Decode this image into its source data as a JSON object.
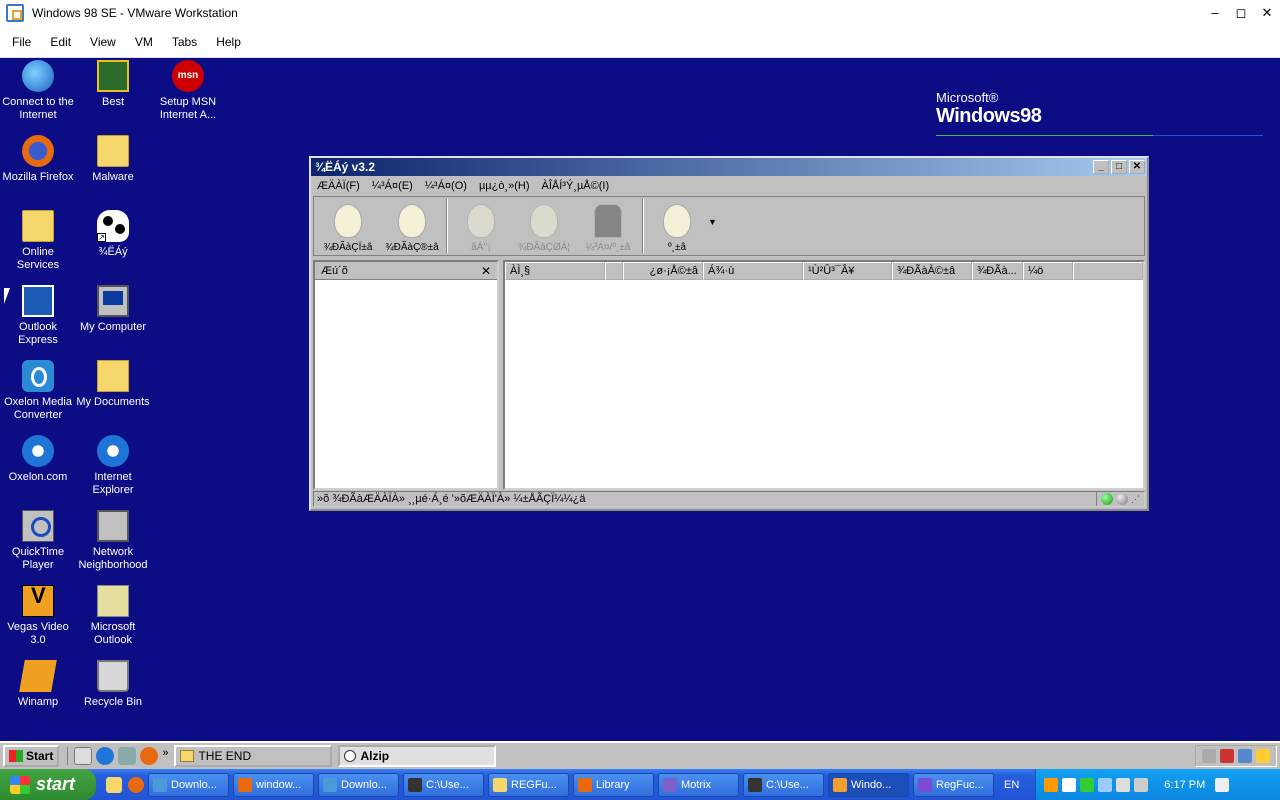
{
  "host": {
    "title": "Windows 98 SE - VMware Workstation",
    "menu": [
      "File",
      "Edit",
      "View",
      "VM",
      "Tabs",
      "Help"
    ],
    "controls": {
      "minimize": "–",
      "maximize": "◻",
      "close": "✕"
    }
  },
  "desktop": {
    "background": "#0c0c84",
    "logo": {
      "line1": "Microsoft®",
      "line2": "Windows98"
    },
    "icons": [
      {
        "label": "Connect to the Internet",
        "icon": "globe"
      },
      {
        "label": "Best",
        "icon": "box"
      },
      {
        "label": "Setup MSN Internet A...",
        "icon": "msn",
        "glyph": "msn"
      },
      {
        "label": "Mozilla Firefox",
        "icon": "firefox"
      },
      {
        "label": "Malware",
        "icon": "folder"
      },
      {
        "label": "Online Services",
        "icon": "folder"
      },
      {
        "label": "¾ËÁý",
        "icon": "cow"
      },
      {
        "label": "Outlook Express",
        "icon": "outlook"
      },
      {
        "label": "My Computer",
        "icon": "computer"
      },
      {
        "label": "Oxelon Media Converter",
        "icon": "oxelon"
      },
      {
        "label": "My Documents",
        "icon": "docs"
      },
      {
        "label": "Oxelon.com",
        "icon": "ie"
      },
      {
        "label": "Internet Explorer",
        "icon": "ie"
      },
      {
        "label": "QuickTime Player",
        "icon": "quick"
      },
      {
        "label": "Network Neighborhood",
        "icon": "net"
      },
      {
        "label": "Vegas Video 3.0",
        "icon": "vegas"
      },
      {
        "label": "Microsoft Outlook",
        "icon": "moutlook"
      },
      {
        "label": "Winamp",
        "icon": "winamp"
      },
      {
        "label": "Recycle Bin",
        "icon": "recycle"
      }
    ]
  },
  "app": {
    "title": "¾ËÁý v3.2",
    "menu": [
      "ÆÄÀÏ(F)",
      "¼³Á¤(E)",
      "¼³Á¤(O)",
      "µµ¿ò¸»(H)",
      "ÀÎÅÍ³Ý¸µÅ©(I)"
    ],
    "toolbar": [
      {
        "label": "¾ÐÃàÇÏ±â",
        "disabled": false
      },
      {
        "label": "¾ÐÃàÇ®±â",
        "disabled": false
      },
      {
        "label": "ãÁ°¡",
        "disabled": true
      },
      {
        "label": "¾ÐÃàÇØÁ¦",
        "disabled": true
      },
      {
        "label": "¼³Á¤/º¸±â",
        "disabled": true
      },
      {
        "label": "º¸±â",
        "disabled": false
      }
    ],
    "tree_header": "Æú´õ",
    "list_columns": [
      "ÀÌ¸§",
      "",
      "¿ø·¡Å©±â",
      "Á¾·ù",
      "¹Ù²Û³¯Â¥",
      "¾ÐÃàÀ©±â",
      "¾ÐÃà...",
      "¼ö"
    ],
    "status": "»õ ¾ÐÃàÆÄÀÏÀ» ¸¸µé·Á¸é '»õÆÄÀÏ'À» ¼±ÅÃÇÏ¼¼¿ä"
  },
  "guest_taskbar": {
    "start": "Start",
    "more": "»",
    "tasks": [
      {
        "label": "THE END",
        "active": false
      },
      {
        "label": "Alzip",
        "active": true
      }
    ]
  },
  "host_taskbar": {
    "start": "start",
    "buttons": [
      {
        "label": "Downlo...",
        "color": "#4a9ad8"
      },
      {
        "label": "window...",
        "color": "#e86a10"
      },
      {
        "label": "Downlo...",
        "color": "#4a9ad8"
      },
      {
        "label": "C:\\Use...",
        "color": "#333333"
      },
      {
        "label": "REGFu...",
        "color": "#f5d76e"
      },
      {
        "label": "Library",
        "color": "#e86a10"
      },
      {
        "label": "Motrix",
        "color": "#7b61c9"
      },
      {
        "label": "C:\\Use...",
        "color": "#333333"
      },
      {
        "label": "Windo...",
        "color": "#f0a030",
        "active": true
      },
      {
        "label": "RegFuc...",
        "color": "#7b4bd6"
      }
    ],
    "language": "EN",
    "clock": "6:17 PM"
  }
}
